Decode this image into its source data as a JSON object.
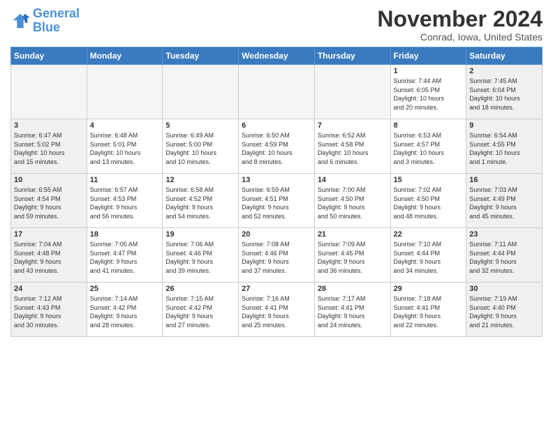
{
  "logo": {
    "line1": "General",
    "line2": "Blue"
  },
  "title": "November 2024",
  "location": "Conrad, Iowa, United States",
  "weekdays": [
    "Sunday",
    "Monday",
    "Tuesday",
    "Wednesday",
    "Thursday",
    "Friday",
    "Saturday"
  ],
  "weeks": [
    [
      {
        "num": "",
        "info": "",
        "type": "empty"
      },
      {
        "num": "",
        "info": "",
        "type": "empty"
      },
      {
        "num": "",
        "info": "",
        "type": "empty"
      },
      {
        "num": "",
        "info": "",
        "type": "empty"
      },
      {
        "num": "",
        "info": "",
        "type": "empty"
      },
      {
        "num": "1",
        "info": "Sunrise: 7:44 AM\nSunset: 6:05 PM\nDaylight: 10 hours\nand 20 minutes.",
        "type": "friday"
      },
      {
        "num": "2",
        "info": "Sunrise: 7:45 AM\nSunset: 6:04 PM\nDaylight: 10 hours\nand 18 minutes.",
        "type": "saturday"
      }
    ],
    [
      {
        "num": "3",
        "info": "Sunrise: 6:47 AM\nSunset: 5:02 PM\nDaylight: 10 hours\nand 15 minutes.",
        "type": "sunday"
      },
      {
        "num": "4",
        "info": "Sunrise: 6:48 AM\nSunset: 5:01 PM\nDaylight: 10 hours\nand 13 minutes.",
        "type": "normal"
      },
      {
        "num": "5",
        "info": "Sunrise: 6:49 AM\nSunset: 5:00 PM\nDaylight: 10 hours\nand 10 minutes.",
        "type": "normal"
      },
      {
        "num": "6",
        "info": "Sunrise: 6:50 AM\nSunset: 4:59 PM\nDaylight: 10 hours\nand 8 minutes.",
        "type": "normal"
      },
      {
        "num": "7",
        "info": "Sunrise: 6:52 AM\nSunset: 4:58 PM\nDaylight: 10 hours\nand 6 minutes.",
        "type": "normal"
      },
      {
        "num": "8",
        "info": "Sunrise: 6:53 AM\nSunset: 4:57 PM\nDaylight: 10 hours\nand 3 minutes.",
        "type": "normal"
      },
      {
        "num": "9",
        "info": "Sunrise: 6:54 AM\nSunset: 4:55 PM\nDaylight: 10 hours\nand 1 minute.",
        "type": "saturday"
      }
    ],
    [
      {
        "num": "10",
        "info": "Sunrise: 6:55 AM\nSunset: 4:54 PM\nDaylight: 9 hours\nand 59 minutes.",
        "type": "sunday"
      },
      {
        "num": "11",
        "info": "Sunrise: 6:57 AM\nSunset: 4:53 PM\nDaylight: 9 hours\nand 56 minutes.",
        "type": "normal"
      },
      {
        "num": "12",
        "info": "Sunrise: 6:58 AM\nSunset: 4:52 PM\nDaylight: 9 hours\nand 54 minutes.",
        "type": "normal"
      },
      {
        "num": "13",
        "info": "Sunrise: 6:59 AM\nSunset: 4:51 PM\nDaylight: 9 hours\nand 52 minutes.",
        "type": "normal"
      },
      {
        "num": "14",
        "info": "Sunrise: 7:00 AM\nSunset: 4:50 PM\nDaylight: 9 hours\nand 50 minutes.",
        "type": "normal"
      },
      {
        "num": "15",
        "info": "Sunrise: 7:02 AM\nSunset: 4:50 PM\nDaylight: 9 hours\nand 48 minutes.",
        "type": "normal"
      },
      {
        "num": "16",
        "info": "Sunrise: 7:03 AM\nSunset: 4:49 PM\nDaylight: 9 hours\nand 45 minutes.",
        "type": "saturday"
      }
    ],
    [
      {
        "num": "17",
        "info": "Sunrise: 7:04 AM\nSunset: 4:48 PM\nDaylight: 9 hours\nand 43 minutes.",
        "type": "sunday"
      },
      {
        "num": "18",
        "info": "Sunrise: 7:05 AM\nSunset: 4:47 PM\nDaylight: 9 hours\nand 41 minutes.",
        "type": "normal"
      },
      {
        "num": "19",
        "info": "Sunrise: 7:06 AM\nSunset: 4:46 PM\nDaylight: 9 hours\nand 39 minutes.",
        "type": "normal"
      },
      {
        "num": "20",
        "info": "Sunrise: 7:08 AM\nSunset: 4:46 PM\nDaylight: 9 hours\nand 37 minutes.",
        "type": "normal"
      },
      {
        "num": "21",
        "info": "Sunrise: 7:09 AM\nSunset: 4:45 PM\nDaylight: 9 hours\nand 36 minutes.",
        "type": "normal"
      },
      {
        "num": "22",
        "info": "Sunrise: 7:10 AM\nSunset: 4:44 PM\nDaylight: 9 hours\nand 34 minutes.",
        "type": "normal"
      },
      {
        "num": "23",
        "info": "Sunrise: 7:11 AM\nSunset: 4:44 PM\nDaylight: 9 hours\nand 32 minutes.",
        "type": "saturday"
      }
    ],
    [
      {
        "num": "24",
        "info": "Sunrise: 7:12 AM\nSunset: 4:43 PM\nDaylight: 9 hours\nand 30 minutes.",
        "type": "sunday"
      },
      {
        "num": "25",
        "info": "Sunrise: 7:14 AM\nSunset: 4:42 PM\nDaylight: 9 hours\nand 28 minutes.",
        "type": "normal"
      },
      {
        "num": "26",
        "info": "Sunrise: 7:15 AM\nSunset: 4:42 PM\nDaylight: 9 hours\nand 27 minutes.",
        "type": "normal"
      },
      {
        "num": "27",
        "info": "Sunrise: 7:16 AM\nSunset: 4:41 PM\nDaylight: 9 hours\nand 25 minutes.",
        "type": "normal"
      },
      {
        "num": "28",
        "info": "Sunrise: 7:17 AM\nSunset: 4:41 PM\nDaylight: 9 hours\nand 24 minutes.",
        "type": "normal"
      },
      {
        "num": "29",
        "info": "Sunrise: 7:18 AM\nSunset: 4:41 PM\nDaylight: 9 hours\nand 22 minutes.",
        "type": "normal"
      },
      {
        "num": "30",
        "info": "Sunrise: 7:19 AM\nSunset: 4:40 PM\nDaylight: 9 hours\nand 21 minutes.",
        "type": "saturday"
      }
    ]
  ]
}
